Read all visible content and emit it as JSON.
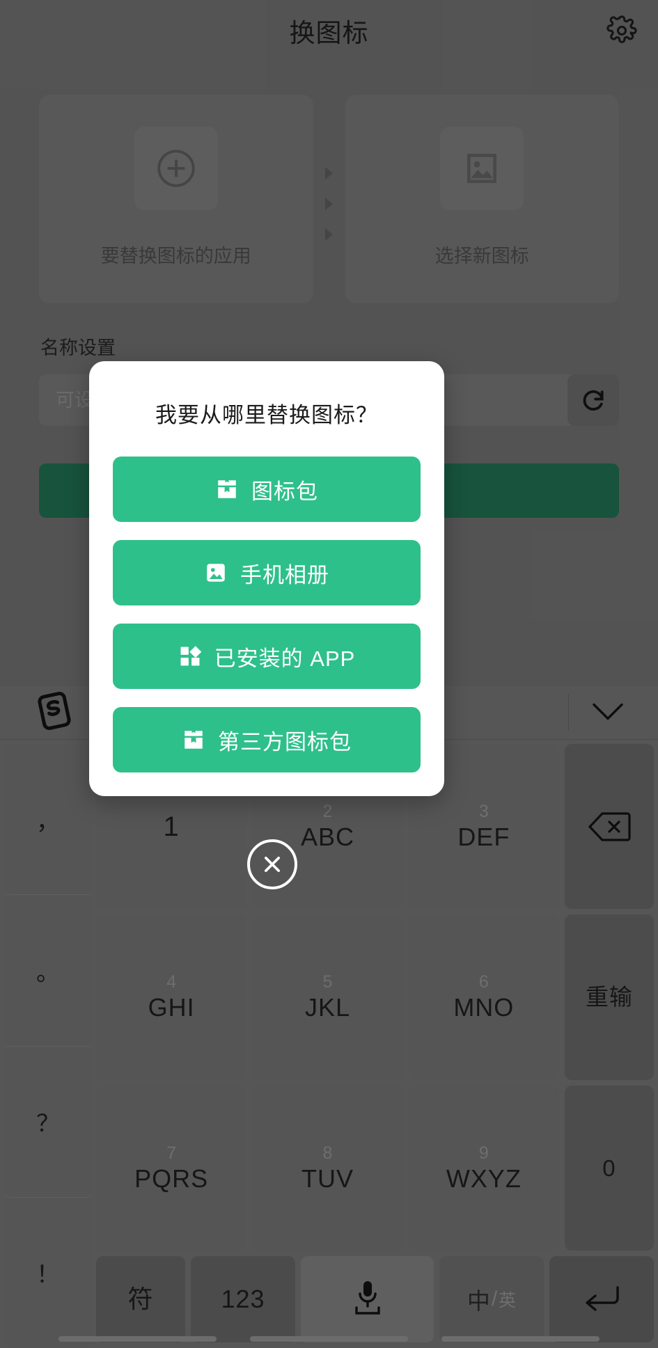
{
  "header": {
    "title": "换图标",
    "settings_icon": "gear-icon"
  },
  "picker": {
    "left_card": {
      "label": "要替换图标的应用",
      "icon": "plus-circle-icon"
    },
    "right_card": {
      "label": "选择新图标",
      "icon": "image-icon"
    },
    "arrow_icon": "chevron-right-icon"
  },
  "name_settings": {
    "section_label": "名称设置",
    "input_value": "",
    "input_placeholder": "可设置新的图标名称",
    "refresh_icon": "refresh-icon"
  },
  "dialog": {
    "title": "我要从哪里替换图标？",
    "close_icon": "close-circle-icon",
    "options": [
      {
        "label": "图标包",
        "icon": "icon-pack-icon"
      },
      {
        "label": "手机相册",
        "icon": "photo-icon"
      },
      {
        "label": "已安装的 APP",
        "icon": "apps-grid-icon"
      },
      {
        "label": "第三方图标包",
        "icon": "icon-pack-icon"
      }
    ]
  },
  "keyboard": {
    "toolbar": {
      "logo": "sogou-logo-icon",
      "collapse_icon": "chevron-down-icon"
    },
    "punctuation": [
      "，",
      "。",
      "？",
      "！"
    ],
    "rows": [
      [
        {
          "num": "1",
          "alpha": "",
          "type": "digit"
        },
        {
          "num": "2",
          "alpha": "ABC",
          "type": "letters"
        },
        {
          "num": "3",
          "alpha": "DEF",
          "type": "letters"
        },
        {
          "num": "",
          "alpha": "",
          "type": "backspace",
          "icon": "backspace-icon"
        }
      ],
      [
        {
          "num": "4",
          "alpha": "GHI",
          "type": "letters"
        },
        {
          "num": "5",
          "alpha": "JKL",
          "type": "letters"
        },
        {
          "num": "6",
          "alpha": "MNO",
          "type": "letters"
        },
        {
          "num": "",
          "alpha": "重输",
          "type": "func"
        }
      ],
      [
        {
          "num": "7",
          "alpha": "PQRS",
          "type": "letters"
        },
        {
          "num": "8",
          "alpha": "TUV",
          "type": "letters"
        },
        {
          "num": "9",
          "alpha": "WXYZ",
          "type": "letters"
        },
        {
          "num": "",
          "alpha": "0",
          "type": "func"
        }
      ]
    ],
    "bottom_row": {
      "symbol": "符",
      "numeric": "123",
      "space_icon": "microphone-icon",
      "lang_primary": "中",
      "lang_secondary": "英",
      "enter_icon": "enter-icon"
    }
  },
  "colors": {
    "accent_green": "#2ec08a",
    "dialog_bg": "#ffffff",
    "app_bg": "#6b6b6b",
    "primary_button": "#1e6b4f"
  }
}
